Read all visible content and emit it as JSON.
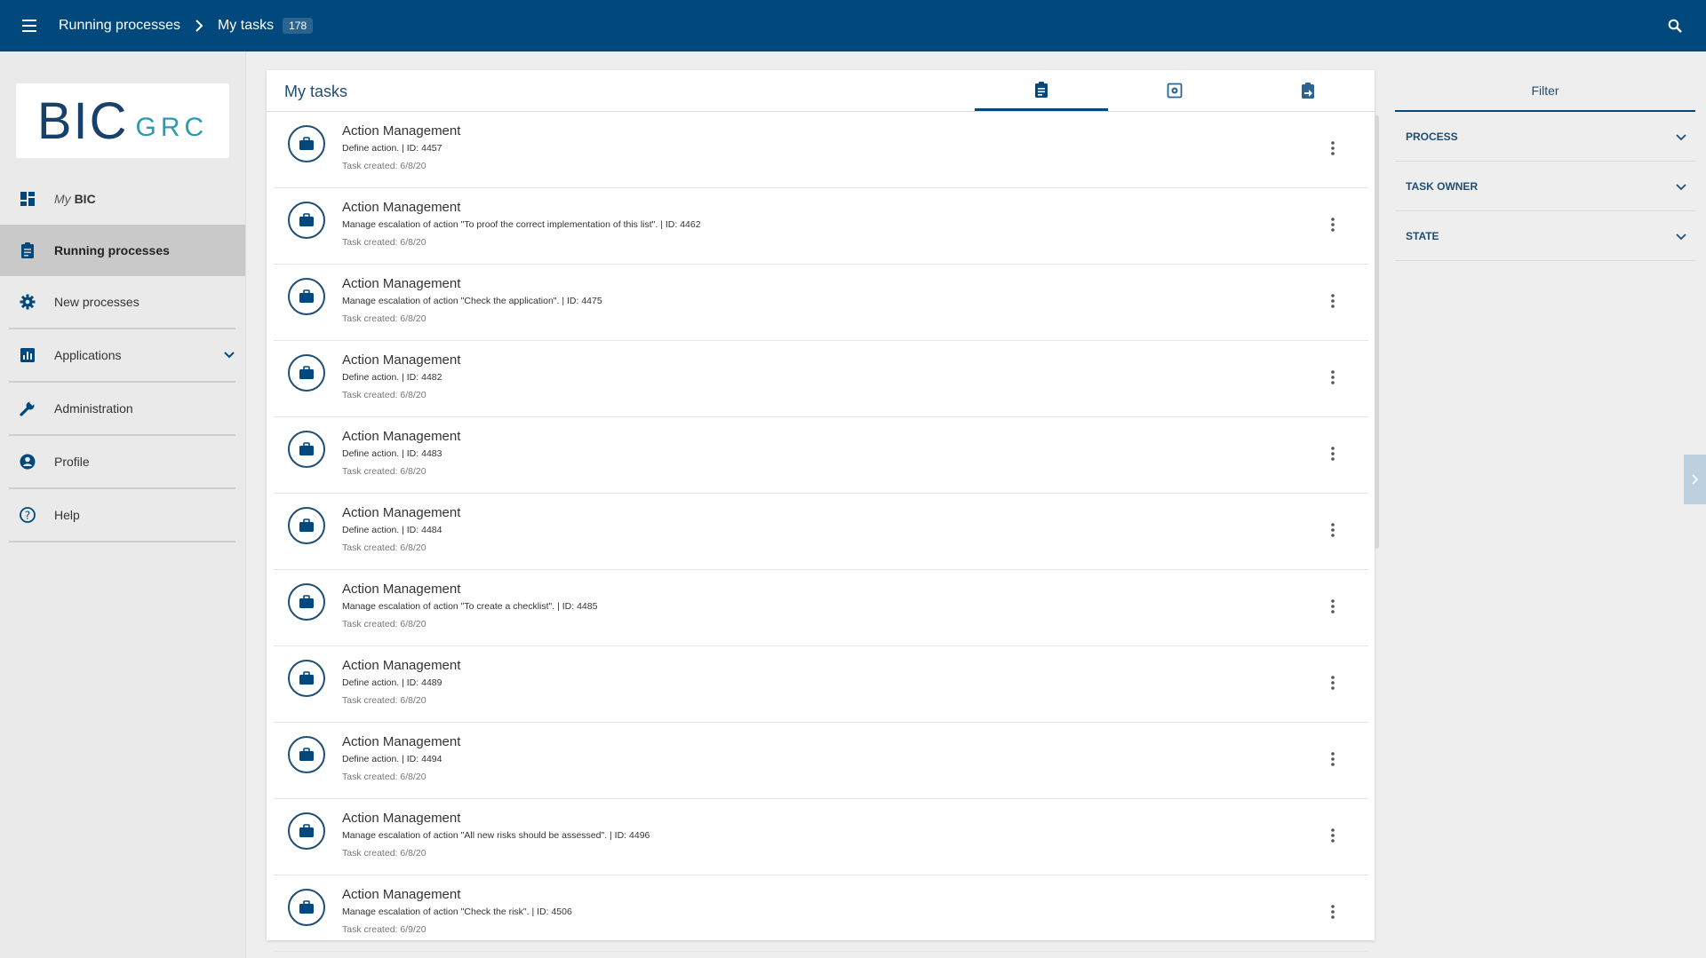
{
  "topbar": {
    "breadcrumb_parent": "Running processes",
    "breadcrumb_current": "My tasks",
    "count_badge": "178"
  },
  "logo": {
    "bic": "BIC",
    "grc": "GRC"
  },
  "nav": {
    "mybic_my": "My",
    "mybic_bic": "BIC",
    "running": "Running processes",
    "new": "New processes",
    "applications": "Applications",
    "administration": "Administration",
    "profile": "Profile",
    "help": "Help"
  },
  "main": {
    "title": "My tasks",
    "tasks": [
      {
        "title": "Action Management",
        "desc": "Define action. | ID: 4457",
        "date": "Task created: 6/8/20"
      },
      {
        "title": "Action Management",
        "desc": "Manage escalation of action \"To proof the correct implementation of this list\". | ID: 4462",
        "date": "Task created: 6/8/20"
      },
      {
        "title": "Action Management",
        "desc": "Manage escalation of action \"Check the application\". | ID: 4475",
        "date": "Task created: 6/8/20"
      },
      {
        "title": "Action Management",
        "desc": "Define action. | ID: 4482",
        "date": "Task created: 6/8/20"
      },
      {
        "title": "Action Management",
        "desc": "Define action. | ID: 4483",
        "date": "Task created: 6/8/20"
      },
      {
        "title": "Action Management",
        "desc": "Define action. | ID: 4484",
        "date": "Task created: 6/8/20"
      },
      {
        "title": "Action Management",
        "desc": "Manage escalation of action \"To create a checklist\". | ID: 4485",
        "date": "Task created: 6/8/20"
      },
      {
        "title": "Action Management",
        "desc": "Define action. | ID: 4489",
        "date": "Task created: 6/8/20"
      },
      {
        "title": "Action Management",
        "desc": "Define action. | ID: 4494",
        "date": "Task created: 6/8/20"
      },
      {
        "title": "Action Management",
        "desc": "Manage escalation of action \"All new risks should be assessed\". | ID: 4496",
        "date": "Task created: 6/8/20"
      },
      {
        "title": "Action Management",
        "desc": "Manage escalation of action \"Check the risk\". | ID: 4506",
        "date": "Task created: 6/9/20"
      }
    ]
  },
  "filter": {
    "title": "Filter",
    "process": "PROCESS",
    "task_owner": "TASK OWNER",
    "state": "STATE"
  },
  "colors": {
    "primary": "#01497c",
    "accent": "#1f4e74",
    "logo_teal": "#2b9bb2",
    "sidebar_bg": "#eaeaea",
    "active_nav": "#c9c9c9"
  }
}
